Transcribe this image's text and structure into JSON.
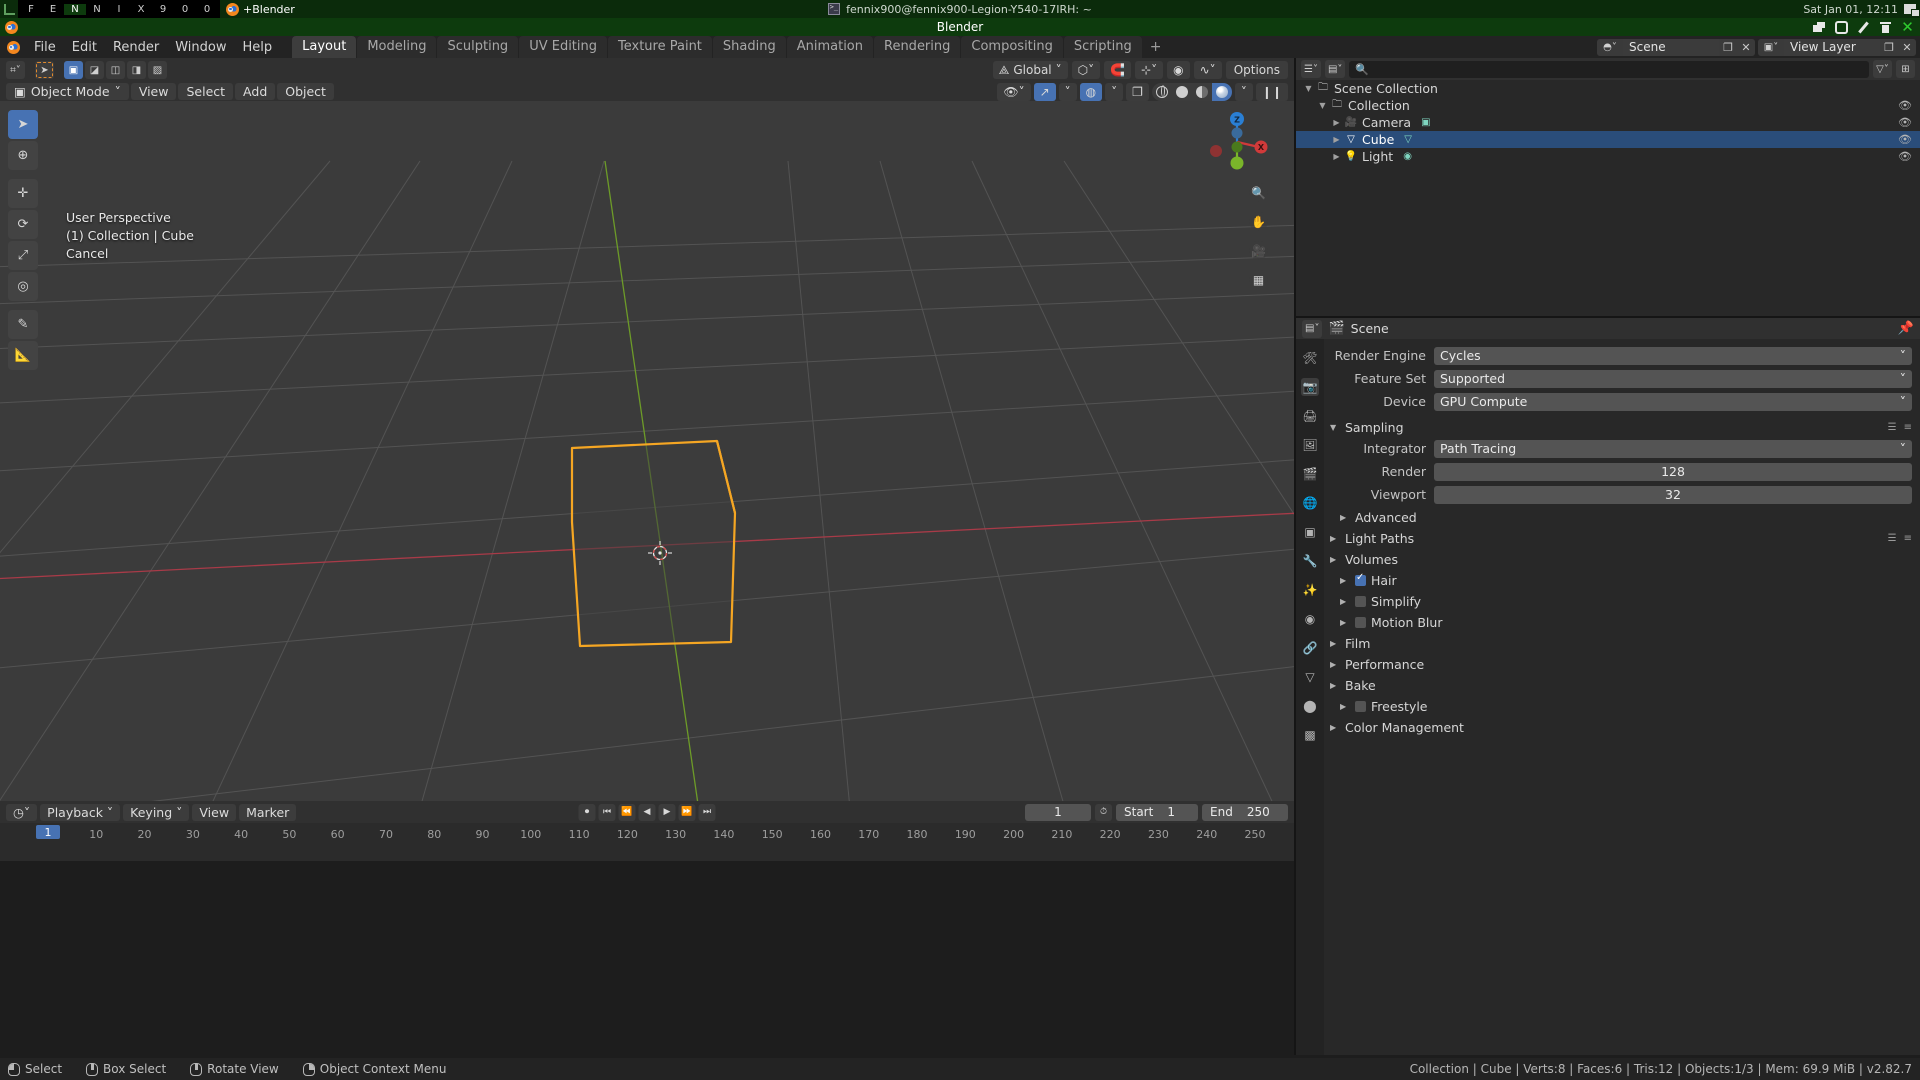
{
  "os_bar": {
    "workspaces": [
      "F",
      "E",
      "N",
      "N",
      "I",
      "X",
      "9",
      "0",
      "0"
    ],
    "active_workspace_index": 2,
    "task_label": "+Blender",
    "terminal_title": "fennix900@fennix900-Legion-Y540-17IRH: ~",
    "clock": "Sat Jan 01, 12:11"
  },
  "window": {
    "title": "Blender"
  },
  "topbar": {
    "menus": [
      "File",
      "Edit",
      "Render",
      "Window",
      "Help"
    ],
    "workspace_tabs": [
      "Layout",
      "Modeling",
      "Sculpting",
      "UV Editing",
      "Texture Paint",
      "Shading",
      "Animation",
      "Rendering",
      "Compositing",
      "Scripting"
    ],
    "active_tab": "Layout",
    "add_tab_label": "+",
    "scene_name": "Scene",
    "view_layer_name": "View Layer"
  },
  "viewport_tool_header": {
    "transform_orientation": "Global",
    "options_label": "Options"
  },
  "viewport_header": {
    "mode": "Object Mode",
    "menus": [
      "View",
      "Select",
      "Add",
      "Object"
    ]
  },
  "viewport_overlay": {
    "line1": "User Perspective",
    "line2": "(1) Collection | Cube",
    "line3": "Cancel"
  },
  "gizmo": {
    "axes": [
      {
        "label": "Z",
        "color": "#2a7fd4"
      },
      {
        "label": "X",
        "color": "#d13a3a"
      },
      {
        "label": "Y",
        "color": "#7ab52a"
      }
    ]
  },
  "timeline": {
    "menus": [
      "Playback",
      "Keying",
      "View",
      "Marker"
    ],
    "current_frame": "1",
    "start_label": "Start",
    "start_value": "1",
    "end_label": "End",
    "end_value": "250",
    "playhead_frame": "1",
    "ruler_ticks": [
      "10",
      "20",
      "30",
      "40",
      "50",
      "60",
      "70",
      "80",
      "90",
      "100",
      "110",
      "120",
      "130",
      "140",
      "150",
      "160",
      "170",
      "180",
      "190",
      "200",
      "210",
      "220",
      "230",
      "240",
      "250"
    ]
  },
  "outliner": {
    "search_placeholder": "",
    "rows": [
      {
        "label": "Scene Collection",
        "depth": 0,
        "icon": "collection-icon",
        "selected": false,
        "has_eye": false
      },
      {
        "label": "Collection",
        "depth": 1,
        "icon": "collection-icon",
        "selected": false,
        "has_eye": true
      },
      {
        "label": "Camera",
        "depth": 2,
        "icon": "camera-icon",
        "selected": false,
        "has_eye": true
      },
      {
        "label": "Cube",
        "depth": 2,
        "icon": "mesh-icon",
        "selected": true,
        "has_eye": true
      },
      {
        "label": "Light",
        "depth": 2,
        "icon": "light-icon",
        "selected": false,
        "has_eye": true
      }
    ]
  },
  "properties": {
    "breadcrumb": "Scene",
    "render_engine_label": "Render Engine",
    "render_engine_value": "Cycles",
    "feature_set_label": "Feature Set",
    "feature_set_value": "Supported",
    "device_label": "Device",
    "device_value": "GPU Compute",
    "sampling_label": "Sampling",
    "integrator_label": "Integrator",
    "integrator_value": "Path Tracing",
    "render_label": "Render",
    "render_value": "128",
    "viewport_label": "Viewport",
    "viewport_value": "32",
    "advanced_label": "Advanced",
    "panels": [
      {
        "label": "Light Paths",
        "checkbox": null,
        "indent": 0
      },
      {
        "label": "Volumes",
        "checkbox": null,
        "indent": 0
      },
      {
        "label": "Hair",
        "checkbox": true,
        "indent": 1
      },
      {
        "label": "Simplify",
        "checkbox": false,
        "indent": 1
      },
      {
        "label": "Motion Blur",
        "checkbox": false,
        "indent": 1
      },
      {
        "label": "Film",
        "checkbox": null,
        "indent": 0
      },
      {
        "label": "Performance",
        "checkbox": null,
        "indent": 0
      },
      {
        "label": "Bake",
        "checkbox": null,
        "indent": 0
      },
      {
        "label": "Freestyle",
        "checkbox": false,
        "indent": 1
      },
      {
        "label": "Color Management",
        "checkbox": null,
        "indent": 0
      }
    ]
  },
  "status_bar": {
    "items": [
      {
        "icon": "mouse-left-icon",
        "label": "Select"
      },
      {
        "icon": "mouse-middle-icon",
        "label": "Box Select"
      },
      {
        "icon": "mouse-move-icon",
        "label": "Rotate View"
      },
      {
        "icon": "mouse-right-icon",
        "label": "Object Context Menu"
      }
    ],
    "info": "Collection | Cube | Verts:8 | Faces:6 | Tris:12 | Objects:1/3 | Mem: 69.9 MiB | v2.82.7"
  },
  "colors": {
    "accent": "#4772b3",
    "selection_outline": "#f5a623",
    "x_axis": "#a83b48",
    "y_axis": "#6d9b28",
    "panel_bg": "#282828",
    "header_bg": "#303030",
    "viewport_bg": "#3b3b3b"
  }
}
